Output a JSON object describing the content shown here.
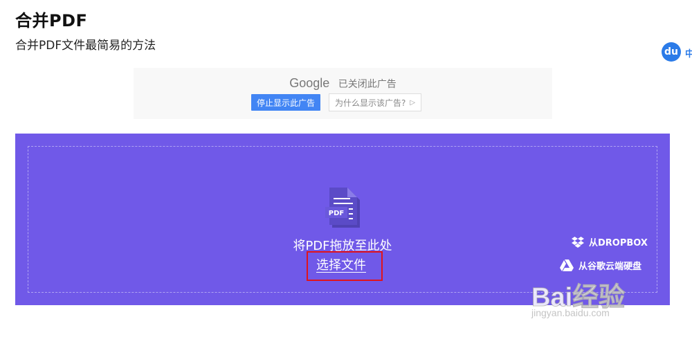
{
  "page": {
    "title": "合并PDF",
    "subtitle": "合并PDF文件最简易的方法"
  },
  "side_badge": {
    "icon_text": "du",
    "text": "中"
  },
  "ad": {
    "brand": "Google",
    "status": "已关闭此广告",
    "stop_label": "停止显示此广告",
    "why_label": "为什么显示该广告?"
  },
  "upload": {
    "drop_text": "将PDF拖放至此处",
    "choose_file": "选择文件",
    "pdf_icon_label": "PDF",
    "dropbox_label": "从DROPBOX",
    "gdrive_label": "从谷歌云端硬盘"
  },
  "watermark": {
    "brand": "Bai经验",
    "url": "jingyan.baidu.com"
  },
  "colors": {
    "drop_zone": "#7059e8",
    "highlight": "#e0131b",
    "ad_button": "#4285f4"
  }
}
